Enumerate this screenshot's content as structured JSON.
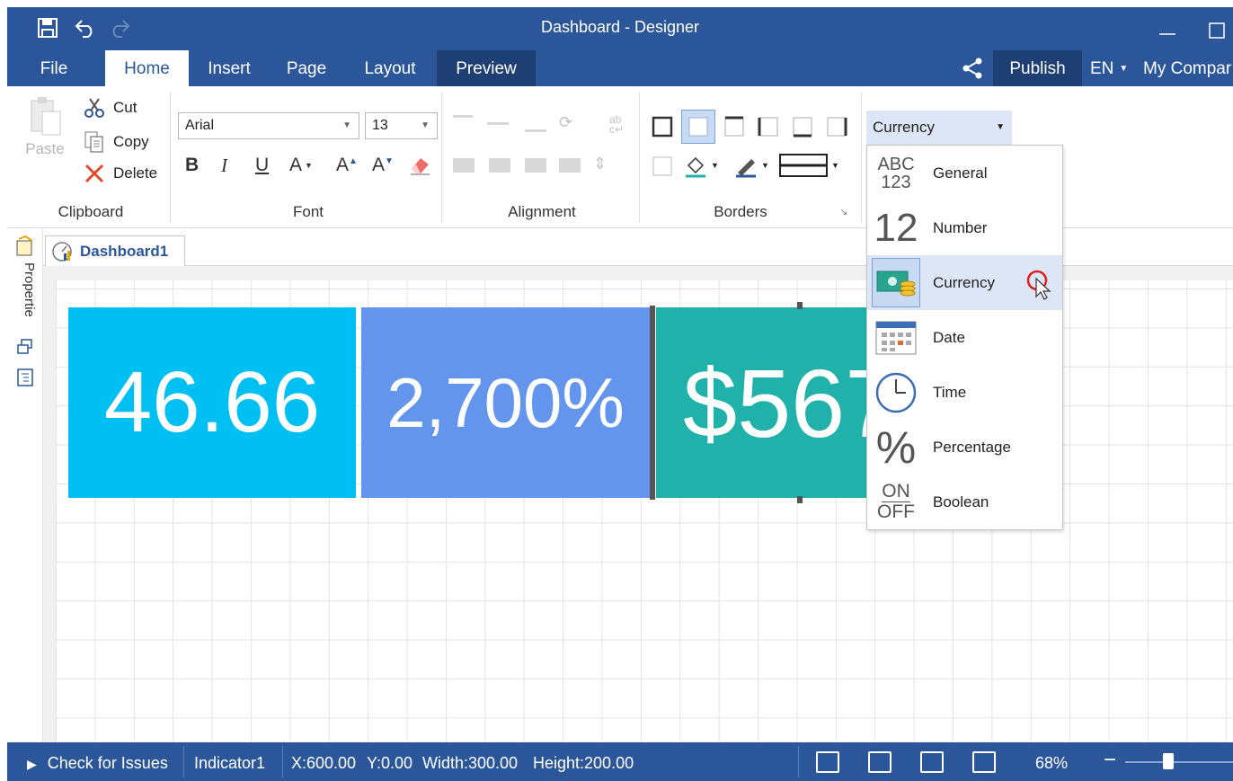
{
  "window": {
    "title": "Dashboard - Designer"
  },
  "menu": {
    "tabs": [
      "File",
      "Home",
      "Insert",
      "Page",
      "Layout",
      "Preview"
    ],
    "active_tab": "Home",
    "publish_label": "Publish",
    "language": "EN",
    "company": "My Compar"
  },
  "ribbon": {
    "clipboard": {
      "label": "Clipboard",
      "paste": "Paste",
      "cut": "Cut",
      "copy": "Copy",
      "delete": "Delete"
    },
    "font": {
      "label": "Font",
      "family": "Arial",
      "size": "13",
      "bold": "B",
      "italic": "I",
      "underline": "U",
      "font_color": "A",
      "grow": "A",
      "shrink": "A"
    },
    "alignment": {
      "label": "Alignment"
    },
    "borders": {
      "label": "Borders"
    },
    "format": {
      "current": "Currency",
      "options": [
        "General",
        "Number",
        "Currency",
        "Date",
        "Time",
        "Percentage",
        "Boolean"
      ],
      "selected": "Currency",
      "general_icon_text_top": "ABC",
      "general_icon_text_bottom": "123",
      "number_icon_text": "12",
      "percentage_icon_text": "%",
      "boolean_icon_text_top": "ON",
      "boolean_icon_text_bottom": "OFF"
    }
  },
  "sidebar": {
    "properties_label": "Propertie"
  },
  "document": {
    "tab": "Dashboard1"
  },
  "indicators": [
    {
      "value": "46.66",
      "color": "#00bff3"
    },
    {
      "value": "2,700%",
      "color": "#6495ed"
    },
    {
      "value": "$567",
      "color": "#20b2aa"
    }
  ],
  "status": {
    "check_issues": "Check for Issues",
    "selection": "Indicator1",
    "x": "X:600.00",
    "y": "Y:0.00",
    "width": "Width:300.00",
    "height": "Height:200.00",
    "zoom": "68%"
  },
  "colors": {
    "accent": "#2b579a",
    "accent_dark": "#1e3f73",
    "selection": "#dce6f7"
  }
}
